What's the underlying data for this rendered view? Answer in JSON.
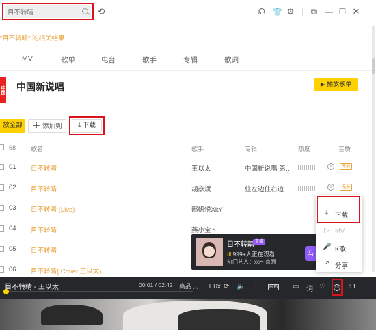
{
  "search": {
    "value": "目不转睛"
  },
  "results_label": {
    "prefix": "“",
    "keyword": "目不转睛",
    "suffix": "”  的相关结果"
  },
  "tabs": [
    "MV",
    "歌单",
    "电台",
    "歌手",
    "专辑",
    "歌词"
  ],
  "album": {
    "cover_text": "中国",
    "title": "中国新说唱",
    "play_label": "播放歌单"
  },
  "actions": {
    "play_all": "放全部",
    "add_to": "添加到",
    "download": "下载"
  },
  "table": {
    "count": "68",
    "columns": {
      "name": "歌名",
      "artist": "歌手",
      "album": "专辑",
      "hot": "热度",
      "quality": "音质"
    },
    "rows": [
      {
        "num": "01",
        "title": "目不转睛",
        "artist": "王以太",
        "album": "中国新说唱 第…",
        "quality": "无损"
      },
      {
        "num": "02",
        "title": "目不转睛",
        "artist": "胡彦斌",
        "album": "住左边住右边…",
        "quality": "无损"
      },
      {
        "num": "03",
        "title": "目不转睛 (Live)",
        "artist": "邢帆悦XkY",
        "album": "",
        "quality": ""
      },
      {
        "num": "04",
        "title": "目不转睛",
        "artist": "燕小宝丶",
        "album": "",
        "quality": ""
      },
      {
        "num": "05",
        "title": "目不转睛",
        "artist": "",
        "album": "",
        "quality": ""
      },
      {
        "num": "06",
        "title": "目不转睛( Cover 王以太)",
        "artist": "",
        "album": "",
        "quality": ""
      }
    ]
  },
  "context_menu": [
    {
      "label": "下载",
      "icon": "download-icon"
    },
    {
      "label": "MV",
      "icon": "mv-icon"
    },
    {
      "label": "K歌",
      "icon": "microphone-icon"
    },
    {
      "label": "分享",
      "icon": "share-icon"
    }
  ],
  "live": {
    "title": "目不转睛",
    "badge": "直播",
    "viewers": "999+人正在观看",
    "hot": "热门艺人：xc～点眼",
    "button": "马"
  },
  "player": {
    "song": "目不转睛 - 王以太",
    "time": "00:01 / 02:42",
    "quality": "高品",
    "speed": "1.0x",
    "lyric": "词",
    "queue_count": "1",
    "progress": 0.006
  },
  "colors": {
    "accent": "#ffd100",
    "highlight": "#d8141c",
    "keyword": "#e8a33d",
    "player_bg": "#26272b"
  }
}
